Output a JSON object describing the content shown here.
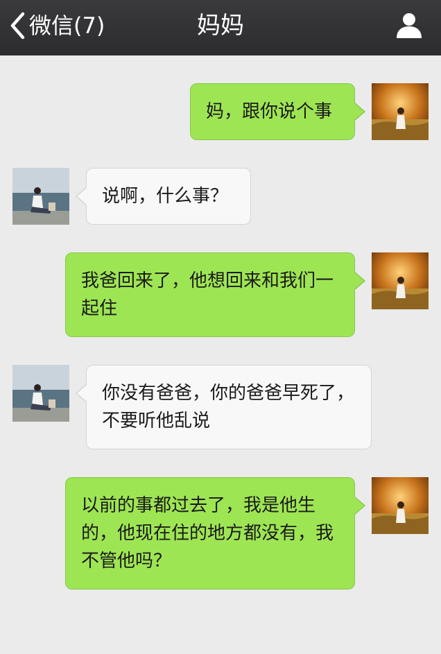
{
  "header": {
    "back_label": "微信(7)",
    "title": "妈妈",
    "profile_icon": "person-icon"
  },
  "colors": {
    "header_bg": "#2f2f32",
    "chat_bg": "#ebebeb",
    "outgoing_bubble": "#9ee554",
    "incoming_bubble": "#f8f8f8"
  },
  "messages": [
    {
      "sender": "self",
      "text": "妈，跟你说个事"
    },
    {
      "sender": "mom",
      "text": "说啊，什么事？"
    },
    {
      "sender": "self",
      "text": "我爸回来了，他想回来和我们一起住"
    },
    {
      "sender": "mom",
      "text": "你没有爸爸，你的爸爸早死了，不要听他乱说"
    },
    {
      "sender": "self",
      "text": "以前的事都过去了，我是他生的，他现在住的地方都没有，我不管他吗？"
    }
  ]
}
